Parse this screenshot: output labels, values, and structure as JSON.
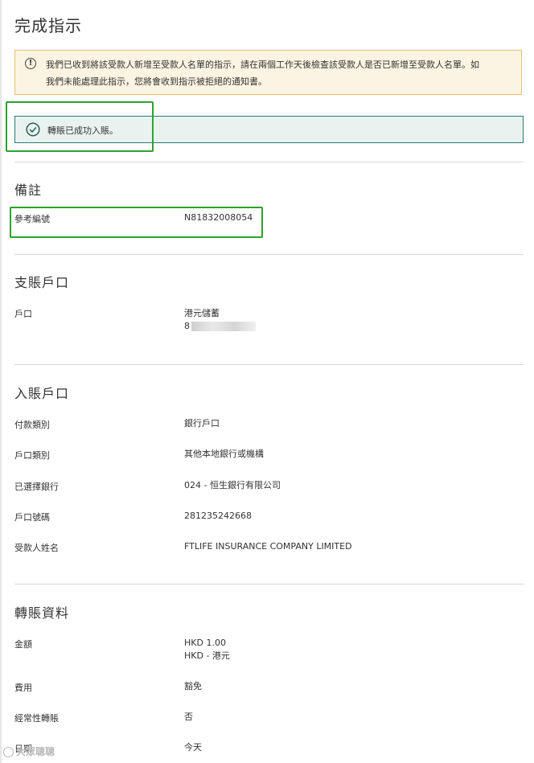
{
  "page": {
    "title": "完成指示"
  },
  "notice": {
    "icon": "exclamation-circle-icon",
    "line1": "我們已收到將該受款人新增至受款人名單的指示，請在兩個工作天後檢查該受款人是否已新增至受款人名單。如",
    "line2": "我們未能處理此指示，您將會收到指示被拒絕的通知書。"
  },
  "success": {
    "icon": "check-circle-icon",
    "text": "轉賬已成功入賬。"
  },
  "remarks": {
    "title": "備註",
    "reference_label": "參考編號",
    "reference_value": "N81832008054"
  },
  "debit_account": {
    "title": "支賬戶口",
    "account_label": "戶口",
    "account_name": "港元儲蓄",
    "account_number_visible": "8"
  },
  "credit_account": {
    "title": "入賬戶口",
    "rows": [
      {
        "label": "付款類別",
        "value": "銀行戶口"
      },
      {
        "label": "戶口類別",
        "value": "其他本地銀行或機構"
      },
      {
        "label": "已選擇銀行",
        "value": "024 - 恒生銀行有限公司"
      },
      {
        "label": "戶口號碼",
        "value": "281235242668"
      },
      {
        "label": "受款人姓名",
        "value": "FTLIFE INSURANCE COMPANY LIMITED"
      }
    ]
  },
  "transfer_details": {
    "title": "轉賬資料",
    "amount_label": "金額",
    "amount_line1": "HKD 1.00",
    "amount_line2": "HKD - 港元",
    "fee_label": "費用",
    "fee_value": "豁免",
    "recurring_label": "經常性轉賬",
    "recurring_value": "否",
    "date_label": "日期",
    "date_value": "今天"
  },
  "watermark": {
    "text": "大眾聰聰"
  },
  "colors": {
    "highlight": "#2aa52a",
    "success_border": "#2b7a6e",
    "notice_border": "#e6c172"
  }
}
